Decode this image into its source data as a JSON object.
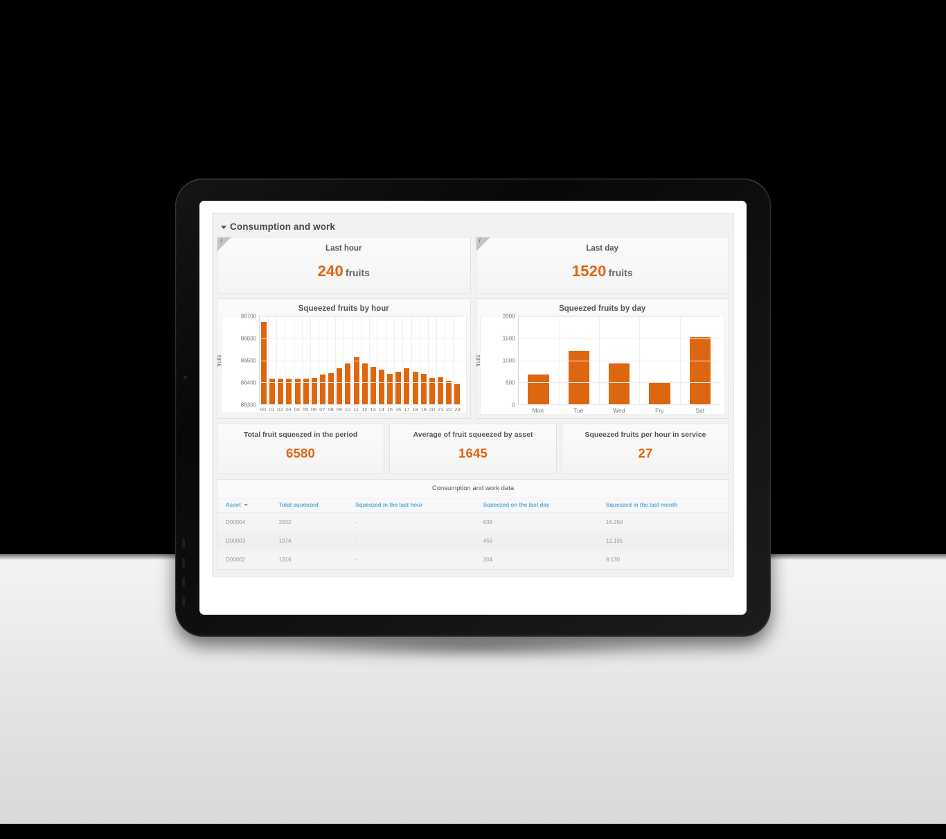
{
  "section": {
    "title": "Consumption and work",
    "collapse_icon": "chevron-down-icon"
  },
  "summary_cards": [
    {
      "title": "Last hour",
      "value": "240",
      "unit": "fruits",
      "info_badge": "i"
    },
    {
      "title": "Last day",
      "value": "1520",
      "unit": "fruits",
      "info_badge": "i"
    }
  ],
  "kpi_cards": [
    {
      "title": "Total fruit squeezed in the period",
      "value": "6580"
    },
    {
      "title": "Average of fruit squeezed by asset",
      "value": "1645"
    },
    {
      "title": "Squeezed fruits per hour in service",
      "value": "27"
    }
  ],
  "charts": {
    "hourly_title": "Squeezed fruits by hour",
    "daily_title": "Squeezed fruits by day"
  },
  "table": {
    "caption": "Consumption and work data",
    "columns": [
      "Asset",
      "Total squeezed",
      "Squeezed in the last hour",
      "Squeezed on the last day",
      "Squeezed in the last month"
    ],
    "sort_column": "Asset",
    "sort_icon": "chevron-down-icon",
    "rows": [
      {
        "asset": "D00004",
        "total": "2632",
        "last_hour": "-",
        "last_day": "638",
        "last_month": "16.260"
      },
      {
        "asset": "D00003",
        "total": "1974",
        "last_hour": "-",
        "last_day": "456",
        "last_month": "12.195"
      },
      {
        "asset": "D00002",
        "total": "1316",
        "last_hour": "-",
        "last_day": "304",
        "last_month": "8.130"
      }
    ]
  },
  "colors": {
    "bar_orange": "#dd6610",
    "value_orange": "#e2630f",
    "header_blue": "#5aa9dd",
    "panel_gray": "#f2f2f2"
  },
  "chart_data": [
    {
      "type": "bar",
      "id": "squeezed-by-hour",
      "title": "Squeezed fruits by hour",
      "xlabel": "",
      "ylabel": "fruits",
      "categories": [
        "00",
        "01",
        "02",
        "03",
        "04",
        "05",
        "06",
        "07",
        "08",
        "09",
        "10",
        "11",
        "12",
        "13",
        "14",
        "15",
        "16",
        "17",
        "18",
        "19",
        "20",
        "21",
        "22",
        "23"
      ],
      "values": [
        86676,
        86417,
        86417,
        86416,
        86417,
        86417,
        86421,
        86436,
        86443,
        86464,
        86486,
        86513,
        86487,
        86469,
        86457,
        86439,
        86448,
        86464,
        86448,
        86438,
        86421,
        86423,
        86406,
        86392
      ],
      "ylim": [
        86300,
        86700
      ],
      "yticks": [
        86300,
        86400,
        86500,
        86600,
        86700
      ],
      "grid": true,
      "legend": "none"
    },
    {
      "type": "bar",
      "id": "squeezed-by-day",
      "title": "Squeezed fruits by day",
      "xlabel": "",
      "ylabel": "fruits",
      "categories": [
        "Mon",
        "Tue",
        "Wed",
        "Fry",
        "Sat"
      ],
      "values": [
        680,
        1210,
        930,
        510,
        1520
      ],
      "ylim": [
        0,
        2000
      ],
      "yticks": [
        0,
        500,
        1000,
        1500,
        2000
      ],
      "grid": true,
      "legend": "none"
    }
  ]
}
